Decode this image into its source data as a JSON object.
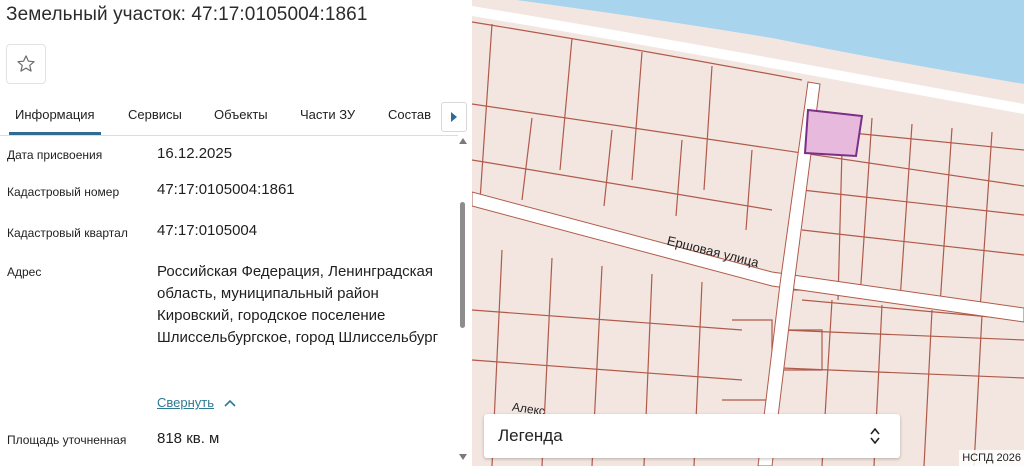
{
  "panel": {
    "title": "Земельный участок: 47:17:0105004:1861",
    "favorite_icon": "star-outline-icon",
    "tabs": [
      {
        "label": "Информация",
        "active": true
      },
      {
        "label": "Сервисы",
        "active": false
      },
      {
        "label": "Объекты",
        "active": false
      },
      {
        "label": "Части ЗУ",
        "active": false
      },
      {
        "label": "Состав",
        "active": false
      }
    ],
    "tabs_next_icon": "chevron-right-icon",
    "accent_color": "#2f6b94",
    "fields": {
      "date": {
        "label": "Дата присвоения",
        "value": "16.12.2025"
      },
      "cadastral_number": {
        "label": "Кадастровый номер",
        "value": "47:17:0105004:1861"
      },
      "cadastral_quarter": {
        "label": "Кадастровый квартал",
        "value": "47:17:0105004"
      },
      "address": {
        "label": "Адрес",
        "value": "Российская Федерация, Ленинградская область, муниципальный район Кировский, городское поселение Шлиссельбургское, город Шлиссельбург"
      },
      "area": {
        "label": "Площадь уточненная",
        "value": "818 кв. м"
      }
    },
    "collapse_link": "Свернуть",
    "collapse_icon": "chevron-up-icon"
  },
  "map": {
    "street_name": "Ершовая улица",
    "street_name_partial": "Алекс",
    "legend_label": "Легенда",
    "legend_icon": "select-arrows-icon",
    "attribution": "НСПД 2026",
    "colors": {
      "water": "#a8d4ee",
      "parcel_fill": "#f3e6e1",
      "parcel_border": "#b05a4a",
      "selected_fill": "#e6b9dd",
      "selected_border": "#7b2f86",
      "road": "#ffffff"
    }
  }
}
